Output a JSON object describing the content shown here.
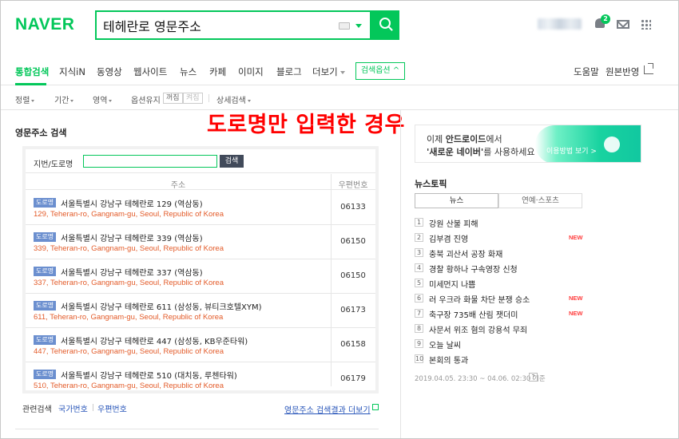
{
  "header": {
    "logo": "NAVER",
    "search_value": "테헤란로 영문주소",
    "notification_count": "2"
  },
  "nav": {
    "items": [
      "통합검색",
      "지식iN",
      "동영상",
      "웹사이트",
      "뉴스",
      "카페",
      "이미지",
      "블로그",
      "더보기"
    ],
    "search_options": "검색옵션 ^",
    "help": "도움말",
    "original": "원본반영"
  },
  "filters": {
    "sort": "정렬",
    "period": "기간",
    "area": "영역",
    "keep_options": "옵션유지",
    "on": "꺼짐",
    "off": "켜짐",
    "detail": "상세검색"
  },
  "caption": "도로명만 입력한 경우",
  "address_section": {
    "title": "영문주소 검색",
    "lookup_label": "지번/도로명",
    "lookup_value": "",
    "lookup_button": "검색",
    "col_address": "주소",
    "col_zip": "우편번호",
    "tag": "도로명",
    "rows": [
      {
        "ko": "서울특별시 강남구 테헤란로 129 (역삼동)",
        "en": "129, Teheran-ro, Gangnam-gu, Seoul, Republic of Korea",
        "zip": "06133"
      },
      {
        "ko": "서울특별시 강남구 테헤란로 339 (역삼동)",
        "en": "339, Teheran-ro, Gangnam-gu, Seoul, Republic of Korea",
        "zip": "06150"
      },
      {
        "ko": "서울특별시 강남구 테헤란로 337 (역삼동)",
        "en": "337, Teheran-ro, Gangnam-gu, Seoul, Republic of Korea",
        "zip": "06150"
      },
      {
        "ko": "서울특별시 강남구 테헤란로 611 (삼성동, 뷰티크호텔XYM)",
        "en": "611, Teheran-ro, Gangnam-gu, Seoul, Republic of Korea",
        "zip": "06173"
      },
      {
        "ko": "서울특별시 강남구 테헤란로 447 (삼성동, KB우준타워)",
        "en": "447, Teheran-ro, Gangnam-gu, Seoul, Republic of Korea",
        "zip": "06158"
      },
      {
        "ko": "서울특별시 강남구 테헤란로 510 (대치동, 루첸타워)",
        "en": "510, Teheran-ro, Gangnam-gu, Seoul, Republic of Korea",
        "zip": "06179"
      }
    ],
    "related_label": "관련검색",
    "related_links": [
      "국가번호",
      "우편번호"
    ],
    "more_link": "영문주소 검색결과 더보기"
  },
  "promo": {
    "line1_pre": "이제 ",
    "line1_bold": "안드로이드",
    "line1_post": "에서",
    "line2_bold": "'새로운 네이버'",
    "line2_post": "를 사용하세요",
    "link": "이용방법 보기 >"
  },
  "news": {
    "title": "뉴스토픽",
    "tabs": [
      "뉴스",
      "연예·스포츠"
    ],
    "items": [
      {
        "num": "1",
        "text": "강원 산불 피해",
        "new": ""
      },
      {
        "num": "2",
        "text": "김부겸 진영",
        "new": "NEW"
      },
      {
        "num": "3",
        "text": "충북 괴산서 공장 화재",
        "new": ""
      },
      {
        "num": "4",
        "text": "경찰 황하나 구속영장 신청",
        "new": ""
      },
      {
        "num": "5",
        "text": "미세먼지 나쁨",
        "new": ""
      },
      {
        "num": "6",
        "text": "러 우크라 화물 차단 분쟁 승소",
        "new": "NEW"
      },
      {
        "num": "7",
        "text": "축구장 735배 산림 잿더미",
        "new": "NEW"
      },
      {
        "num": "8",
        "text": "사문서 위조 혐의 강용석 무죄",
        "new": ""
      },
      {
        "num": "9",
        "text": "오늘 날씨",
        "new": ""
      },
      {
        "num": "10",
        "text": "본회의 통과",
        "new": ""
      }
    ],
    "time": "2019.04.05. 23:30 ~ 04.06. 02:30 기준",
    "help": "?"
  },
  "colors": {
    "brand": "#03c75a",
    "caption": "#ff0000",
    "english_address": "#e35b29",
    "tag": "#6b8fcf"
  }
}
